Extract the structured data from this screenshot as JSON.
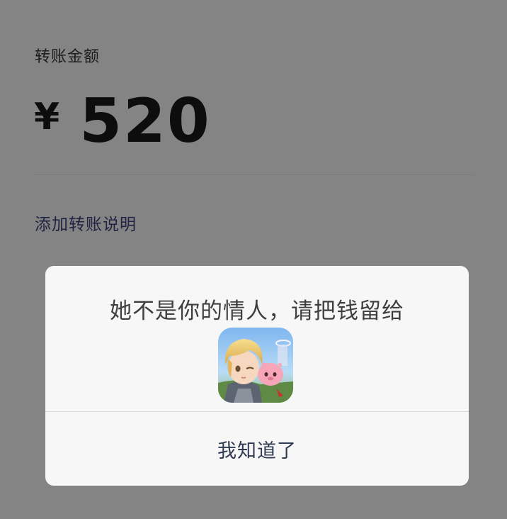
{
  "transfer": {
    "amount_label": "转账金额",
    "currency_symbol": "¥",
    "amount": "520",
    "add_note_link": "添加转账说明"
  },
  "dialog": {
    "message": "她不是你的情人，请把钱留给",
    "image_icon": "game-app-icon",
    "confirm_button": "我知道了"
  },
  "colors": {
    "overlay_background": "#848484",
    "dialog_background": "#f7f7f7",
    "link_text": "#202443",
    "button_text": "#2f3a52"
  }
}
